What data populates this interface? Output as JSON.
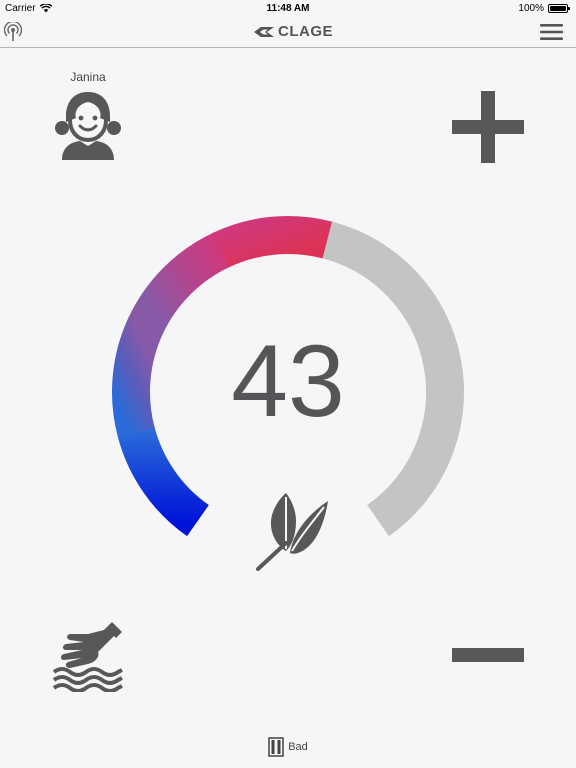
{
  "status_bar": {
    "carrier": "Carrier",
    "time": "11:48 AM",
    "battery": "100%",
    "battery_level": 1.0
  },
  "header": {
    "brand": "CLAGE"
  },
  "user": {
    "name": "Janina"
  },
  "gauge": {
    "value": "43",
    "level": 0.55
  },
  "footer": {
    "location": "Bad"
  },
  "colors": {
    "icon": "#58585a",
    "track": "#c4c4c4",
    "cold": "#0014d8",
    "mid": "#6a57ad",
    "hot": "#d7365d",
    "background": "#f6f6f9"
  }
}
